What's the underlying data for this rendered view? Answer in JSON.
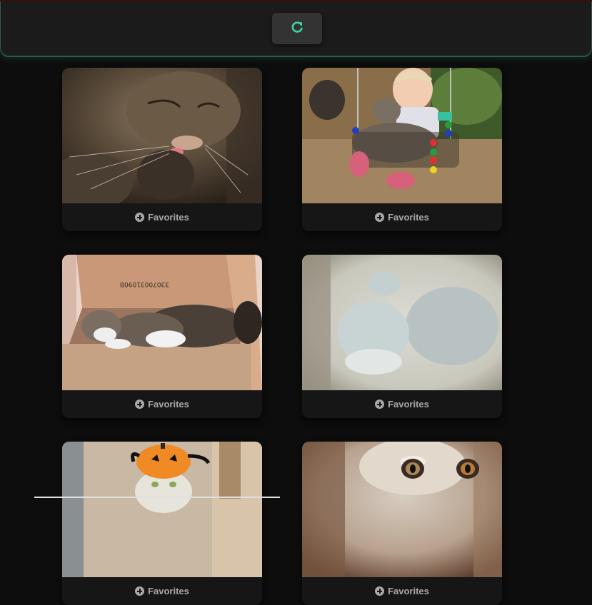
{
  "header": {
    "refresh_icon": "refresh-icon",
    "accent_color": "#3ed6a0"
  },
  "cards": [
    {
      "favorite_label": "Favorites",
      "photo": "cat-licking-paw"
    },
    {
      "favorite_label": "Favorites",
      "photo": "toddler-hugging-cat-on-swing"
    },
    {
      "favorite_label": "Favorites",
      "photo": "cat-sleeping-in-cardboard-box"
    },
    {
      "favorite_label": "Favorites",
      "photo": "blurry-white-kitten"
    },
    {
      "favorite_label": "Favorites",
      "photo": "cat-in-pumpkin-hat"
    },
    {
      "favorite_label": "Favorites",
      "photo": "cat-face-closeup"
    }
  ],
  "icons": {
    "favorite": "plus-circle-icon"
  }
}
